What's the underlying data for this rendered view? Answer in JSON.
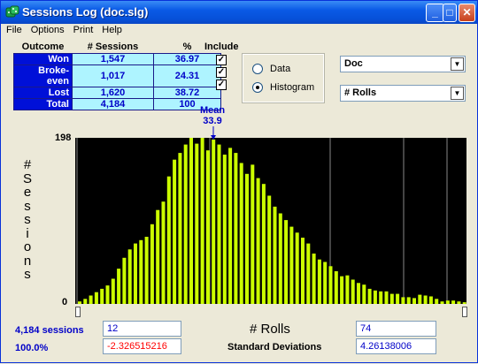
{
  "window": {
    "title": "Sessions Log (doc.slg)"
  },
  "menu": [
    "File",
    "Options",
    "Print",
    "Help"
  ],
  "outcome_table": {
    "headers": [
      "Outcome",
      "# Sessions",
      "%"
    ],
    "rows": [
      {
        "label": "Won",
        "sessions": "1,547",
        "pct": "36.97"
      },
      {
        "label": "Broke-even",
        "sessions": "1,017",
        "pct": "24.31"
      },
      {
        "label": "Lost",
        "sessions": "1,620",
        "pct": "38.72"
      },
      {
        "label": "Total",
        "sessions": "4,184",
        "pct": "100"
      }
    ],
    "include_label": "Include",
    "include_checked": [
      true,
      true,
      true
    ]
  },
  "view": {
    "data_label": "Data",
    "histogram_label": "Histogram",
    "selected": "Histogram"
  },
  "selects": {
    "source": "Doc",
    "metric": "# Rolls"
  },
  "mean": {
    "label": "Mean",
    "value": "33.9"
  },
  "axis": {
    "ylabel": "# Sessions",
    "ymax_label": "198",
    "ymin_label": "0",
    "xlabel": "# Rolls"
  },
  "chart_data": {
    "type": "bar",
    "ymax": 198,
    "mean": 33.9,
    "values": [
      3,
      6,
      10,
      14,
      18,
      22,
      30,
      42,
      55,
      65,
      72,
      76,
      80,
      95,
      112,
      122,
      152,
      172,
      180,
      190,
      198,
      191,
      198,
      183,
      196,
      190,
      178,
      186,
      180,
      168,
      155,
      166,
      150,
      143,
      129,
      116,
      108,
      100,
      92,
      85,
      79,
      72,
      60,
      53,
      50,
      45,
      39,
      33,
      34,
      29,
      25,
      23,
      18,
      16,
      15,
      15,
      12,
      12,
      8,
      8,
      7,
      11,
      10,
      9,
      6,
      3,
      4,
      4,
      3,
      2
    ]
  },
  "footer": {
    "sessions_label": "4,184 sessions",
    "percent_label": "100.0%",
    "low_value": "12",
    "low_sd": "-2.326515216",
    "high_value": "74",
    "high_sd": "4.26138006",
    "sd_label": "Standard Deviations"
  },
  "colors": {
    "bar": "#ccff00",
    "plot_bg": "#000000",
    "sessions_blue": "#0000c8",
    "negative_red": "#ff0000",
    "label_cell": "#0010d8",
    "value_cell": "#aef4ff"
  }
}
